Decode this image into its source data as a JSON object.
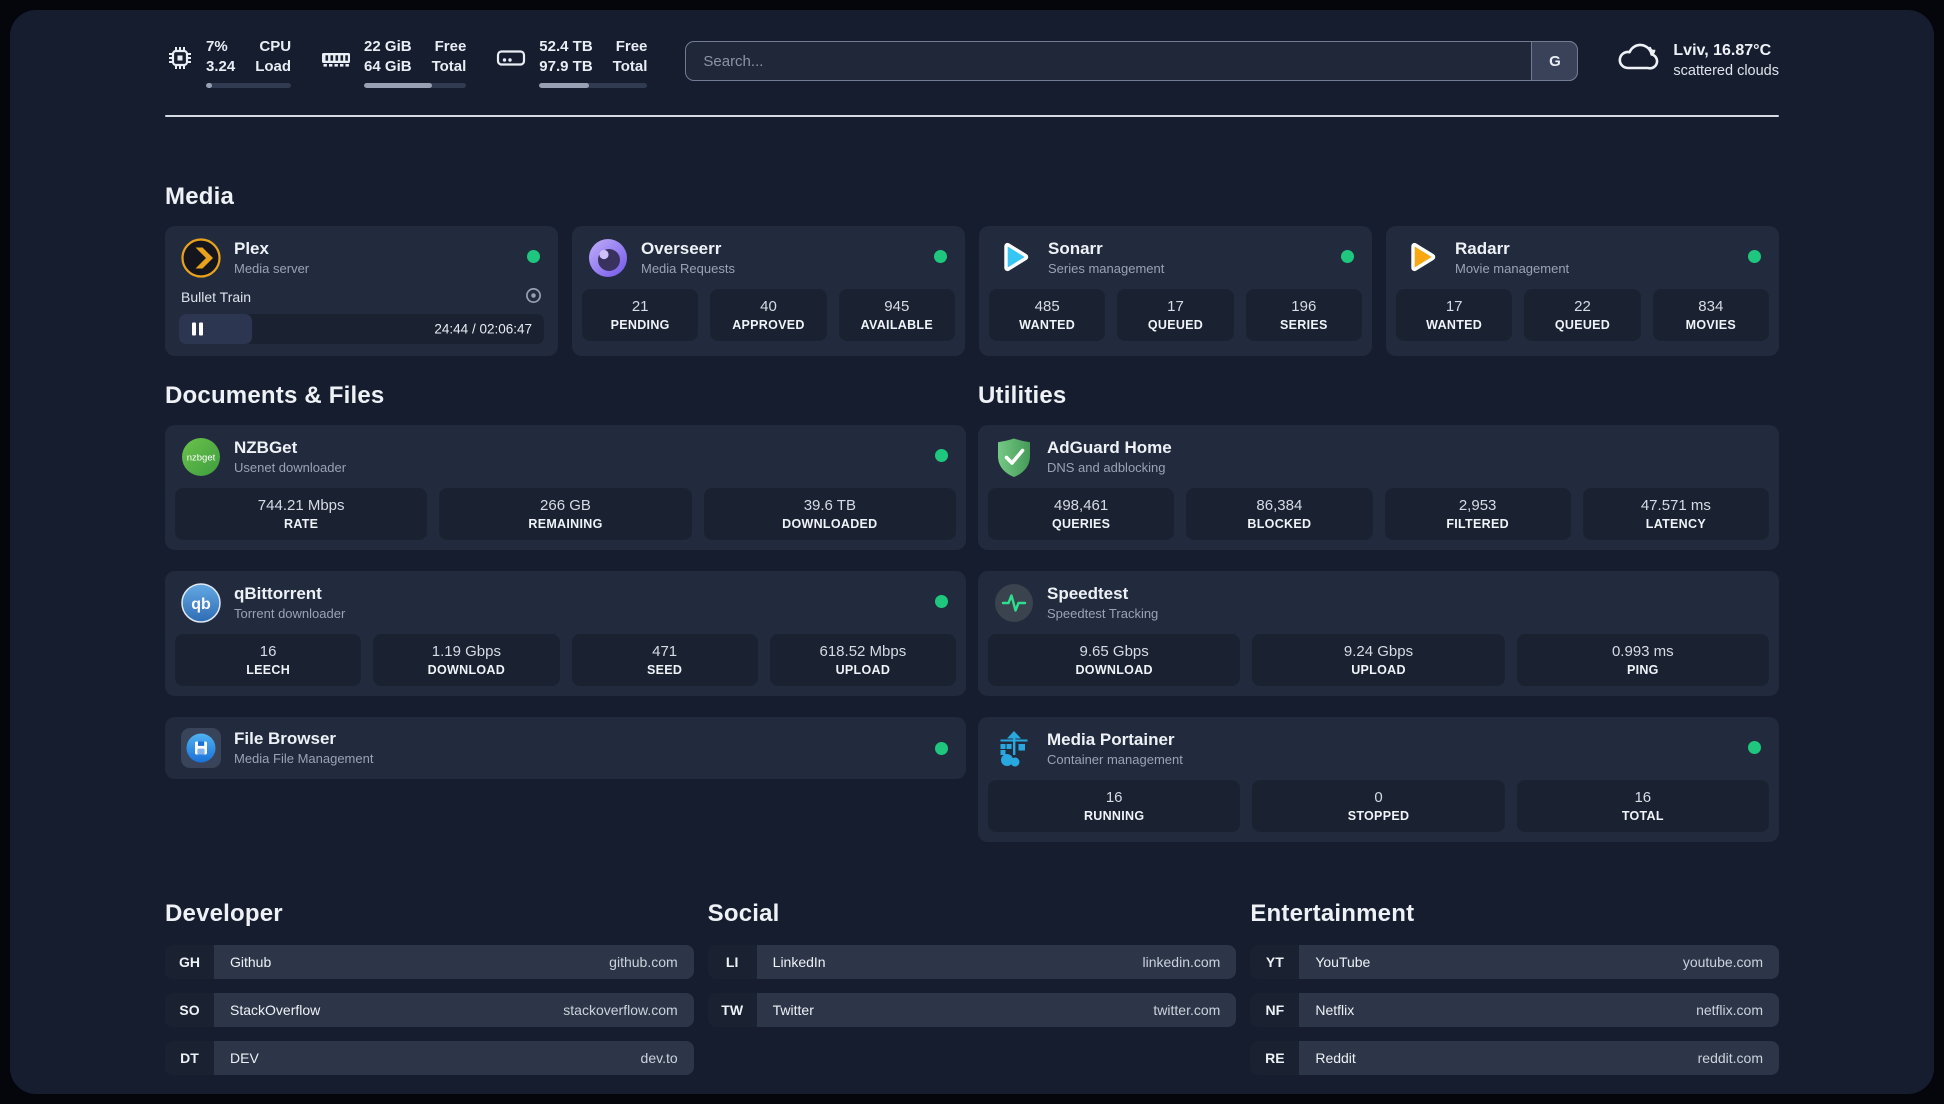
{
  "colors": {
    "panel_bg": "#161d2e",
    "card_bg": "#222b3d",
    "tile_bg": "#1a2232",
    "status_online": "#1fc77e",
    "plex_amber": "#e9a21b",
    "radarr_orange": "#f7a812",
    "sonarr_blue": "#37c6f4",
    "adguard_green": "#59b86c",
    "portainer_blue": "#29a8e0",
    "speedtest_pulse": "#2de08e",
    "divider": "#d5dae3"
  },
  "header": {
    "cpu": {
      "value_top": "7%",
      "value_bottom": "3.24",
      "label_top": "CPU",
      "label_bottom": "Load",
      "bar": "width:7%"
    },
    "memory": {
      "value_top": "22 GiB",
      "value_bottom": "64 GiB",
      "label_top": "Free",
      "label_bottom": "Total",
      "bar": "width:66%"
    },
    "disk": {
      "value_top": "52.4 TB",
      "value_bottom": "97.9 TB",
      "label_top": "Free",
      "label_bottom": "Total",
      "bar": "width:46%"
    },
    "search": {
      "placeholder": "Search...",
      "engine_button": "G"
    },
    "weather": {
      "location": "Lviv, 16.87°C",
      "condition": "scattered clouds"
    }
  },
  "media": {
    "title": "Media",
    "plex": {
      "name": "Plex",
      "description": "Media server",
      "status": "online",
      "now_playing": {
        "track": "Bullet Train",
        "time_display": "24:44 / 02:06:47",
        "progress": "width:20%"
      }
    },
    "overseerr": {
      "name": "Overseerr",
      "description": "Media Requests",
      "status": "online",
      "stats": [
        {
          "value": "21",
          "label": "PENDING"
        },
        {
          "value": "40",
          "label": "APPROVED"
        },
        {
          "value": "945",
          "label": "AVAILABLE"
        }
      ]
    },
    "sonarr": {
      "name": "Sonarr",
      "description": "Series management",
      "status": "online",
      "stats": [
        {
          "value": "485",
          "label": "WANTED"
        },
        {
          "value": "17",
          "label": "QUEUED"
        },
        {
          "value": "196",
          "label": "SERIES"
        }
      ]
    },
    "radarr": {
      "name": "Radarr",
      "description": "Movie management",
      "status": "online",
      "stats": [
        {
          "value": "17",
          "label": "WANTED"
        },
        {
          "value": "22",
          "label": "QUEUED"
        },
        {
          "value": "834",
          "label": "MOVIES"
        }
      ]
    }
  },
  "documents": {
    "title": "Documents & Files",
    "nzbget": {
      "name": "NZBGet",
      "description": "Usenet downloader",
      "status": "online",
      "stats": [
        {
          "value": "744.21 Mbps",
          "label": "RATE"
        },
        {
          "value": "266 GB",
          "label": "REMAINING"
        },
        {
          "value": "39.6 TB",
          "label": "DOWNLOADED"
        }
      ]
    },
    "qbittorrent": {
      "name": "qBittorrent",
      "description": "Torrent downloader",
      "status": "online",
      "stats": [
        {
          "value": "16",
          "label": "LEECH"
        },
        {
          "value": "1.19 Gbps",
          "label": "DOWNLOAD"
        },
        {
          "value": "471",
          "label": "SEED"
        },
        {
          "value": "618.52 Mbps",
          "label": "UPLOAD"
        }
      ]
    },
    "filebrowser": {
      "name": "File Browser",
      "description": "Media File Management",
      "status": "online"
    }
  },
  "utilities": {
    "title": "Utilities",
    "adguard": {
      "name": "AdGuard Home",
      "description": "DNS and adblocking",
      "stats": [
        {
          "value": "498,461",
          "label": "QUERIES"
        },
        {
          "value": "86,384",
          "label": "BLOCKED"
        },
        {
          "value": "2,953",
          "label": "FILTERED"
        },
        {
          "value": "47.571 ms",
          "label": "LATENCY"
        }
      ]
    },
    "speedtest": {
      "name": "Speedtest",
      "description": "Speedtest Tracking",
      "stats": [
        {
          "value": "9.65 Gbps",
          "label": "DOWNLOAD"
        },
        {
          "value": "9.24 Gbps",
          "label": "UPLOAD"
        },
        {
          "value": "0.993 ms",
          "label": "PING"
        }
      ]
    },
    "portainer": {
      "name": "Media Portainer",
      "description": "Container management",
      "status": "online",
      "stats": [
        {
          "value": "16",
          "label": "RUNNING"
        },
        {
          "value": "0",
          "label": "STOPPED"
        },
        {
          "value": "16",
          "label": "TOTAL"
        }
      ]
    }
  },
  "bookmarks": [
    {
      "title": "Developer",
      "items": [
        {
          "abbr": "GH",
          "name": "Github",
          "url": "github.com"
        },
        {
          "abbr": "SO",
          "name": "StackOverflow",
          "url": "stackoverflow.com"
        },
        {
          "abbr": "DT",
          "name": "DEV",
          "url": "dev.to"
        }
      ]
    },
    {
      "title": "Social",
      "items": [
        {
          "abbr": "LI",
          "name": "LinkedIn",
          "url": "linkedin.com"
        },
        {
          "abbr": "TW",
          "name": "Twitter",
          "url": "twitter.com"
        }
      ]
    },
    {
      "title": "Entertainment",
      "items": [
        {
          "abbr": "YT",
          "name": "YouTube",
          "url": "youtube.com"
        },
        {
          "abbr": "NF",
          "name": "Netflix",
          "url": "netflix.com"
        },
        {
          "abbr": "RE",
          "name": "Reddit",
          "url": "reddit.com"
        }
      ]
    }
  ]
}
